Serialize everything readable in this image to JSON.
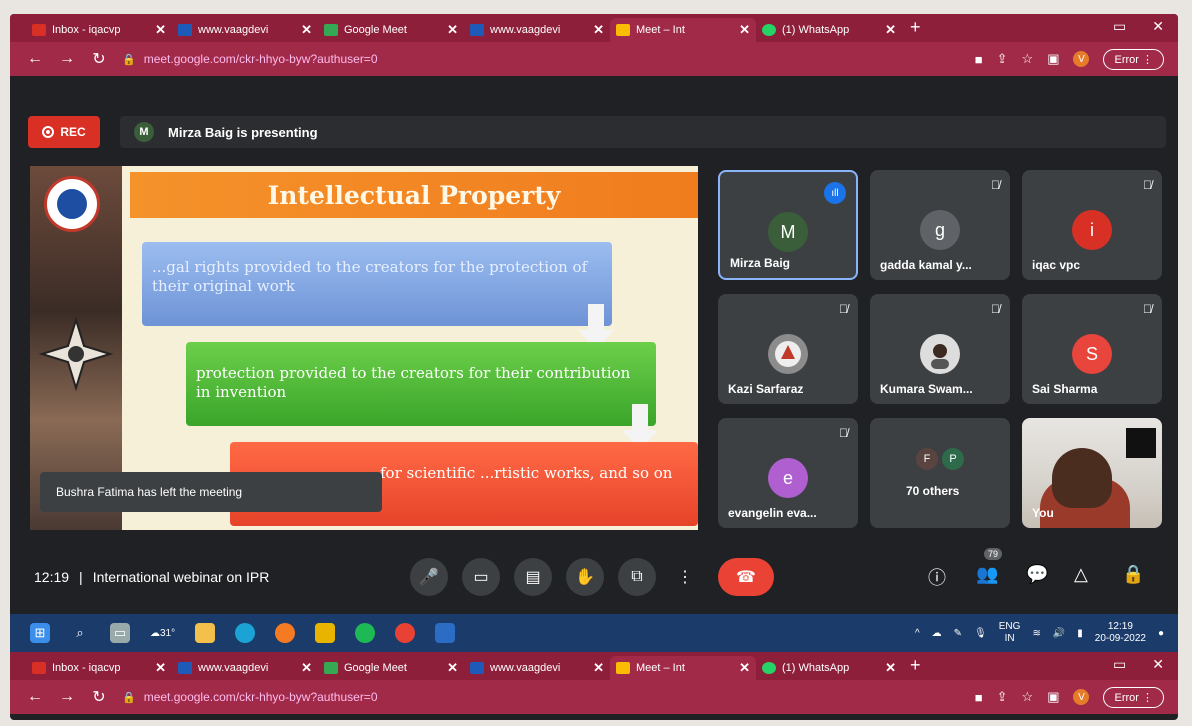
{
  "browser": {
    "tabs": [
      {
        "title": "Inbox - iqacvp",
        "color": "#d93025"
      },
      {
        "title": "www.vaagdevi",
        "color": "#1e5bb8"
      },
      {
        "title": "Google Meet",
        "color": "#34a853"
      },
      {
        "title": "www.vaagdevi",
        "color": "#1e5bb8"
      },
      {
        "title": "Meet – Int",
        "color": "#fbbc04"
      },
      {
        "title": "(1) WhatsApp",
        "color": "#25d366"
      }
    ],
    "tab_close": "✕",
    "new_tab": "+",
    "url": "meet.google.com/ckr-hhyo-byw?authuser=0",
    "error_label": "Error",
    "profile_initial": "V"
  },
  "meet": {
    "rec_label": "REC",
    "presenter_initial": "M",
    "presenting_text": "Mirza Baig is presenting",
    "toast": "Bushra Fatima has left the meeting",
    "time": "12:19",
    "separator": "|",
    "meeting_title": "International webinar on IPR",
    "participant_count": "79",
    "participants": [
      {
        "name": "Mirza Baig",
        "initial": "M",
        "color": "#3b5e3a",
        "speaking": true
      },
      {
        "name": "gadda kamal y...",
        "initial": "g",
        "color": "#5f6368",
        "muted": true
      },
      {
        "name": "iqac vpc",
        "initial": "i",
        "color": "#d93025",
        "muted": true
      },
      {
        "name": "Kazi Sarfaraz",
        "initial": "",
        "color": "#7a7a7a",
        "muted": true
      },
      {
        "name": "Kumara Swam...",
        "initial": "",
        "color": "#6b6b6b",
        "muted": true
      },
      {
        "name": "Sai Sharma",
        "initial": "S",
        "color": "#e8453c",
        "muted": true
      },
      {
        "name": "evangelin eva...",
        "initial": "e",
        "color": "#b05fd1",
        "muted": true
      },
      {
        "name": "70 others",
        "initial": "",
        "color": "#3c4043"
      },
      {
        "name": "You",
        "initial": "",
        "color": "#cfcac4"
      }
    ],
    "others_initials": [
      "F",
      "P"
    ]
  },
  "slide": {
    "title": "Intellectual Property",
    "box1": "...gal rights provided to the creators for the protection of their original work",
    "box2": "protection provided to the creators for their contribution in invention",
    "box3": "for scientific ...rtistic works, and so on"
  },
  "taskbar": {
    "weather": "31°",
    "lang1": "ENG",
    "lang2": "IN",
    "clock_time": "12:19",
    "clock_date": "20-09-2022"
  }
}
